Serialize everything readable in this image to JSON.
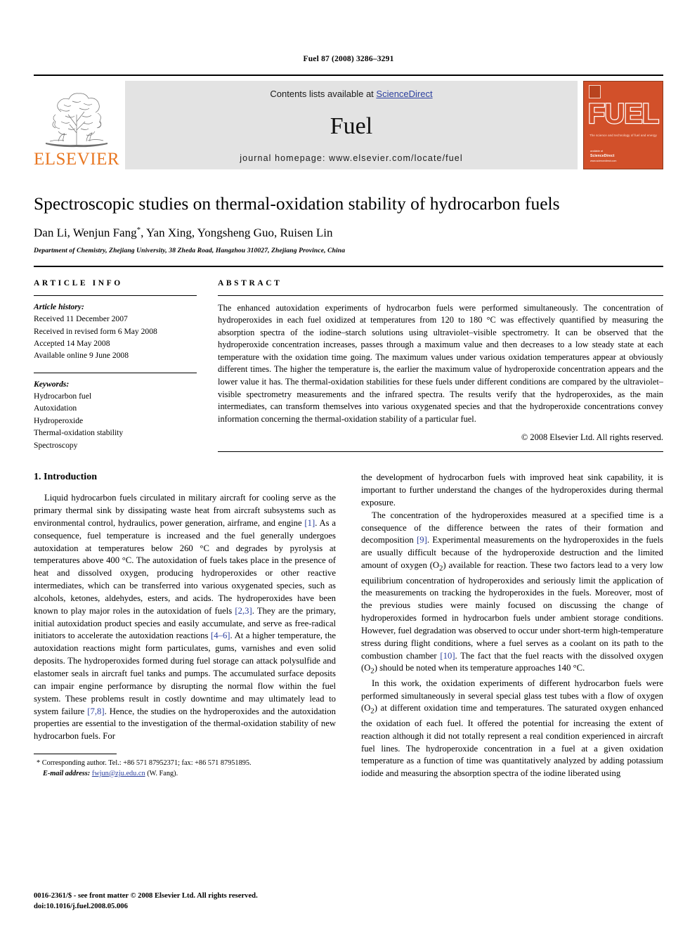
{
  "running_head": "Fuel 87 (2008) 3286–3291",
  "masthead": {
    "contents_prefix": "Contents lists available at ",
    "sciencedirect": "ScienceDirect",
    "journal_name": "Fuel",
    "homepage": "journal homepage: www.elsevier.com/locate/fuel",
    "publisher_logo_text": "ELSEVIER",
    "cover": {
      "title": "FUEL",
      "subtitle": "The science and technology of fuel and energy",
      "sciencedirect_label": "available at",
      "sciencedirect_name": "ScienceDirect",
      "sciencedirect_url": "www.sciencedirect.com"
    }
  },
  "article": {
    "title": "Spectroscopic studies on thermal-oxidation stability of hydrocarbon fuels",
    "authors": "Dan Li, Wenjun Fang *, Yan Xing, Yongsheng Guo, Ruisen Lin",
    "affiliation": "Department of Chemistry, Zhejiang University, 38 Zheda Road, Hangzhou 310027, Zhejiang Province, China"
  },
  "article_info": {
    "heading": "ARTICLE INFO",
    "history_label": "Article history:",
    "history": [
      "Received 11 December 2007",
      "Received in revised form 6 May 2008",
      "Accepted 14 May 2008",
      "Available online 9 June 2008"
    ],
    "keywords_label": "Keywords:",
    "keywords": [
      "Hydrocarbon fuel",
      "Autoxidation",
      "Hydroperoxide",
      "Thermal-oxidation stability",
      "Spectroscopy"
    ]
  },
  "abstract": {
    "heading": "ABSTRACT",
    "text": "The enhanced autoxidation experiments of hydrocarbon fuels were performed simultaneously. The concentration of hydroperoxides in each fuel oxidized at temperatures from 120 to 180 °C was effectively quantified by measuring the absorption spectra of the iodine–starch solutions using ultraviolet–visible spectrometry. It can be observed that the hydroperoxide concentration increases, passes through a maximum value and then decreases to a low steady state at each temperature with the oxidation time going. The maximum values under various oxidation temperatures appear at obviously different times. The higher the temperature is, the earlier the maximum value of hydroperoxide concentration appears and the lower value it has. The thermal-oxidation stabilities for these fuels under different conditions are compared by the ultraviolet–visible spectrometry measurements and the infrared spectra. The results verify that the hydroperoxides, as the main intermediates, can transform themselves into various oxygenated species and that the hydroperoxide concentrations convey information concerning the thermal-oxidation stability of a particular fuel.",
    "copyright": "© 2008 Elsevier Ltd. All rights reserved."
  },
  "body": {
    "section_heading": "1. Introduction",
    "left_paragraphs": [
      "Liquid hydrocarbon fuels circulated in military aircraft for cooling serve as the primary thermal sink by dissipating waste heat from aircraft subsystems such as environmental control, hydraulics, power generation, airframe, and engine [1]. As a consequence, fuel temperature is increased and the fuel generally undergoes autoxidation at temperatures below 260 °C and degrades by pyrolysis at temperatures above 400 °C. The autoxidation of fuels takes place in the presence of heat and dissolved oxygen, producing hydroperoxides or other reactive intermediates, which can be transferred into various oxygenated species, such as alcohols, ketones, aldehydes, esters, and acids. The hydroperoxides have been known to play major roles in the autoxidation of fuels [2,3]. They are the primary, initial autoxidation product species and easily accumulate, and serve as free-radical initiators to accelerate the autoxidation reactions [4–6]. At a higher temperature, the autoxidation reactions might form particulates, gums, varnishes and even solid deposits. The hydroperoxides formed during fuel storage can attack polysulfide and elastomer seals in aircraft fuel tanks and pumps. The accumulated surface deposits can impair engine performance by disrupting the normal flow within the fuel system. These problems result in costly downtime and may ultimately lead to system failure [7,8]. Hence, the studies on the hydroperoxides and the autoxidation properties are essential to the investigation of the thermal-oxidation stability of new hydrocarbon fuels. For"
    ],
    "right_paragraphs": [
      "the development of hydrocarbon fuels with improved heat sink capability, it is important to further understand the changes of the hydroperoxides during thermal exposure.",
      "The concentration of the hydroperoxides measured at a specified time is a consequence of the difference between the rates of their formation and decomposition [9]. Experimental measurements on the hydroperoxides in the fuels are usually difficult because of the hydroperoxide destruction and the limited amount of oxygen (O2) available for reaction. These two factors lead to a very low equilibrium concentration of hydroperoxides and seriously limit the application of the measurements on tracking the hydroperoxides in the fuels. Moreover, most of the previous studies were mainly focused on discussing the change of hydroperoxides formed in hydrocarbon fuels under ambient storage conditions. However, fuel degradation was observed to occur under short-term high-temperature stress during flight conditions, where a fuel serves as a coolant on its path to the combustion chamber [10]. The fact that the fuel reacts with the dissolved oxygen (O2) should be noted when its temperature approaches 140 °C.",
      "In this work, the oxidation experiments of different hydrocarbon fuels were performed simultaneously in several special glass test tubes with a flow of oxygen (O2) at different oxidation time and temperatures. The saturated oxygen enhanced the oxidation of each fuel. It offered the potential for increasing the extent of reaction although it did not totally represent a real condition experienced in aircraft fuel lines. The hydroperoxide concentration in a fuel at a given oxidation temperature as a function of time was quantitatively analyzed by adding potassium iodide and measuring the absorption spectra of the iodine liberated using"
    ]
  },
  "footnote": {
    "marker": "*",
    "corresponding": "Corresponding author. Tel.: +86 571 87952371; fax: +86 571 87951895.",
    "email_label": "E-mail address:",
    "email": "fwjun@zju.edu.cn",
    "email_suffix": "(W. Fang)."
  },
  "colophon": {
    "line1": "0016-2361/$ - see front matter © 2008 Elsevier Ltd. All rights reserved.",
    "line2": "doi:10.1016/j.fuel.2008.05.006"
  },
  "colors": {
    "link": "#2b3f9e",
    "elsevier_orange": "#E87722",
    "cover_orange": "#d2502a",
    "band_grey": "#e3e3e3"
  }
}
